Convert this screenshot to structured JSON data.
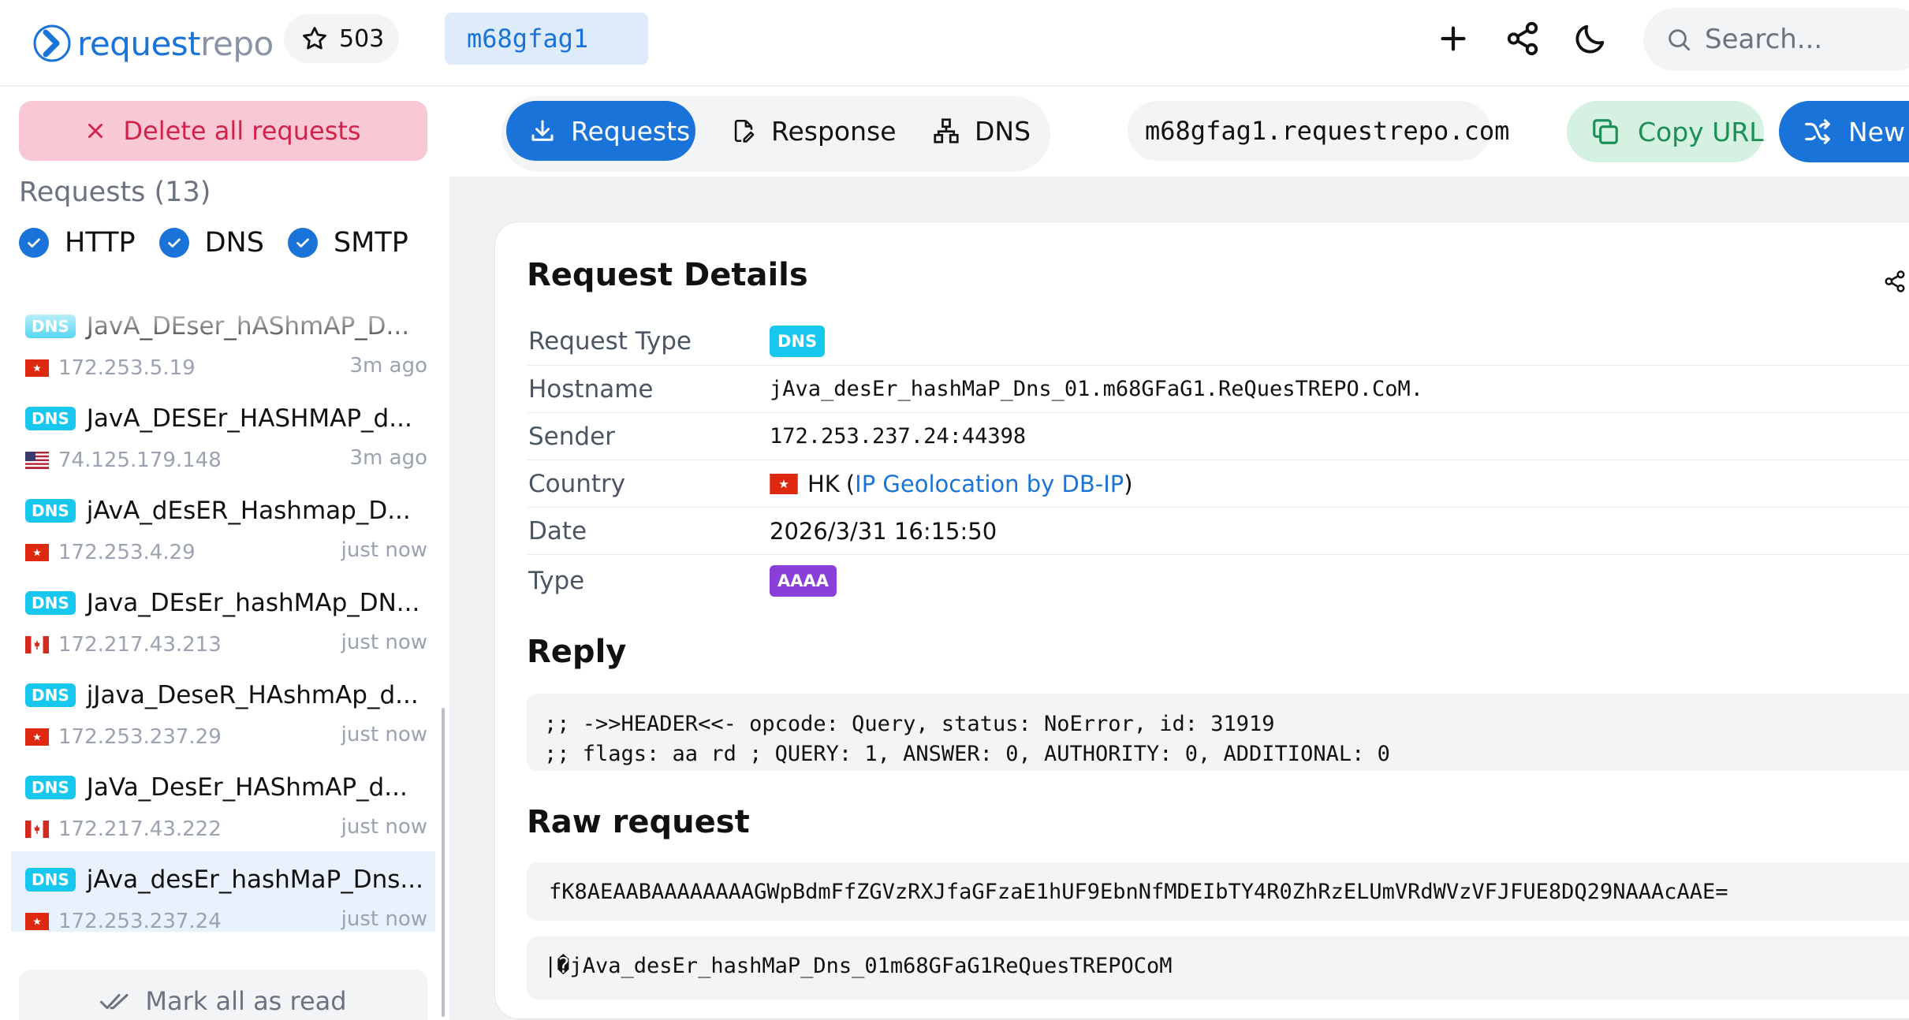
{
  "colors": {
    "accent": "#1a73d8",
    "danger_bg": "#f8c9d5",
    "danger_text": "#d1224a",
    "copy_bg": "#d5f1e2",
    "copy_text": "#1a8f56",
    "dns_badge": "#18c7ee",
    "aaaa_badge": "#8b3fd9"
  },
  "header": {
    "logo_part1": "request",
    "logo_part2": "repo",
    "star_count": "503",
    "subdomain": "m68gfag1",
    "search_placeholder": "Search...",
    "icons": [
      "plus-icon",
      "share-icon",
      "moon-icon",
      "search-icon"
    ]
  },
  "sidebar": {
    "delete_label": "Delete all requests",
    "requests_count_label": "Requests (13)",
    "filters": [
      {
        "label": "HTTP",
        "checked": true
      },
      {
        "label": "DNS",
        "checked": true
      },
      {
        "label": "SMTP",
        "checked": true
      }
    ],
    "requests": [
      {
        "type": "DNS",
        "name": "JavA_DEser_hAShmAP_D...",
        "ip": "172.253.5.19",
        "time": "3m ago",
        "flag": "hk"
      },
      {
        "type": "DNS",
        "name": "JavA_DESEr_HASHMAP_d...",
        "ip": "74.125.179.148",
        "time": "3m ago",
        "flag": "us"
      },
      {
        "type": "DNS",
        "name": "jAvA_dEsER_Hashmap_D...",
        "ip": "172.253.4.29",
        "time": "just now",
        "flag": "hk"
      },
      {
        "type": "DNS",
        "name": "Java_DEsEr_hashMAp_DN...",
        "ip": "172.217.43.213",
        "time": "just now",
        "flag": "ca"
      },
      {
        "type": "DNS",
        "name": "jJava_DeseR_HAshmAp_d...",
        "ip": "172.253.237.29",
        "time": "just now",
        "flag": "hk"
      },
      {
        "type": "DNS",
        "name": "JaVa_DesEr_HAShmAP_d...",
        "ip": "172.217.43.222",
        "time": "just now",
        "flag": "ca"
      },
      {
        "type": "DNS",
        "name": "jAva_desEr_hashMaP_Dns...",
        "ip": "172.253.237.24",
        "time": "just now",
        "flag": "hk",
        "selected": true
      }
    ],
    "mark_read_label": "Mark all as read"
  },
  "toolbar": {
    "tabs": [
      {
        "label": "Requests",
        "icon": "download-icon",
        "active": true
      },
      {
        "label": "Response",
        "icon": "file-edit-icon",
        "active": false
      },
      {
        "label": "DNS",
        "icon": "network-icon",
        "active": false
      }
    ],
    "url": "m68gfag1.requestrepo.com",
    "copy_label": "Copy URL",
    "new_label": "New U"
  },
  "details": {
    "title": "Request Details",
    "rows": [
      {
        "label": "Request Type",
        "value": "DNS",
        "kind": "badge-dns"
      },
      {
        "label": "Hostname",
        "value": "jAva_desEr_hashMaP_Dns_01.m68GFaG1.ReQuesTREPO.CoM.",
        "kind": "mono"
      },
      {
        "label": "Sender",
        "value": "172.253.237.24:44398",
        "kind": "mono"
      },
      {
        "label": "Country",
        "value": "HK",
        "link_text": "IP Geolocation by DB-IP",
        "kind": "country"
      },
      {
        "label": "Date",
        "value": "2026/3/31 16:15:50",
        "kind": "text"
      },
      {
        "label": "Type",
        "value": "AAAA",
        "kind": "badge-aaaa"
      }
    ],
    "reply_title": "Reply",
    "reply_lines": [
      ";; ->>HEADER<<- opcode: Query, status: NoError, id: 31919",
      ";; flags: aa rd ; QUERY: 1, ANSWER: 0, AUTHORITY: 0, ADDITIONAL: 0"
    ],
    "raw_title": "Raw request",
    "raw_base64": "fK8AEAABAAAAAAAAGWpBdmFfZGVzRXJfaGFzaE1hUF9EbnNfMDEIbTY4R0ZhRzELUmVRdWVzVFJFUE8DQ29NAAAcAAE=",
    "raw_decoded": "|�jAva_desEr_hashMaP_Dns_01m68GFaG1ReQuesTREPOCoM"
  }
}
